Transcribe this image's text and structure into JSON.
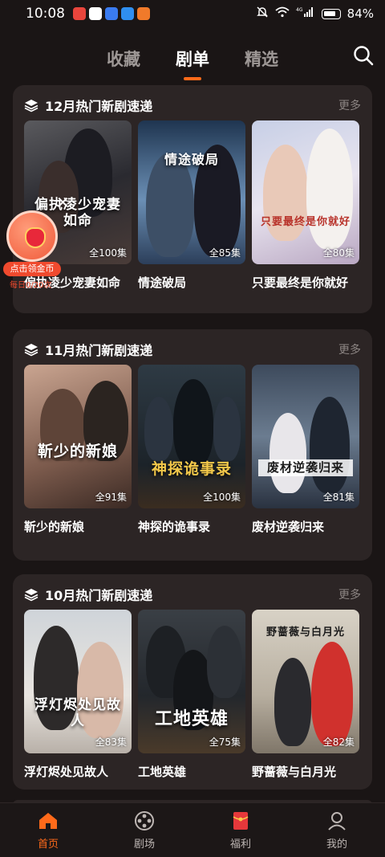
{
  "status_bar": {
    "time": "10:08",
    "network": "4G",
    "battery": "84%"
  },
  "top_tabs": [
    {
      "label": "收藏",
      "active": false
    },
    {
      "label": "剧单",
      "active": true
    },
    {
      "label": "精选",
      "active": false
    }
  ],
  "accent_color": "#ff6a1a",
  "sections": [
    {
      "title": "12月热门新剧速递",
      "more": "更多",
      "items": [
        {
          "title": "偏执凌少宠妻如命",
          "episodes": "全100集",
          "poster_text": "偏执凌少宠妻如命"
        },
        {
          "title": "情途破局",
          "episodes": "全85集",
          "poster_text": "情途破局"
        },
        {
          "title": "只要最终是你就好",
          "episodes": "全80集",
          "poster_text": "只要最终是你就好"
        }
      ]
    },
    {
      "title": "11月热门新剧速递",
      "more": "更多",
      "items": [
        {
          "title": "靳少的新娘",
          "episodes": "全91集",
          "poster_text": "靳少的新娘"
        },
        {
          "title": "神探的诡事录",
          "episodes": "全100集",
          "poster_text": "神探诡事录"
        },
        {
          "title": "废材逆袭归来",
          "episodes": "全81集",
          "poster_text": "废材逆袭归来"
        }
      ]
    },
    {
      "title": "10月热门新剧速递",
      "more": "更多",
      "items": [
        {
          "title": "浮灯烬处见故人",
          "episodes": "全83集",
          "poster_text": "浮灯烬处见故人"
        },
        {
          "title": "工地英雄",
          "episodes": "全75集",
          "poster_text": "工地英雄"
        },
        {
          "title": "野蔷薇与白月光",
          "episodes": "全82集",
          "poster_text": "野蔷薇与白月光"
        }
      ]
    }
  ],
  "coin_widget": {
    "button_label": "点击领金币",
    "sub_text": "每日0/20次"
  },
  "bottom_nav": [
    {
      "label": "首页",
      "icon": "home-icon",
      "active": true
    },
    {
      "label": "剧场",
      "icon": "film-reel-icon",
      "active": false
    },
    {
      "label": "福利",
      "icon": "red-envelope-icon",
      "active": false
    },
    {
      "label": "我的",
      "icon": "profile-icon",
      "active": false
    }
  ]
}
